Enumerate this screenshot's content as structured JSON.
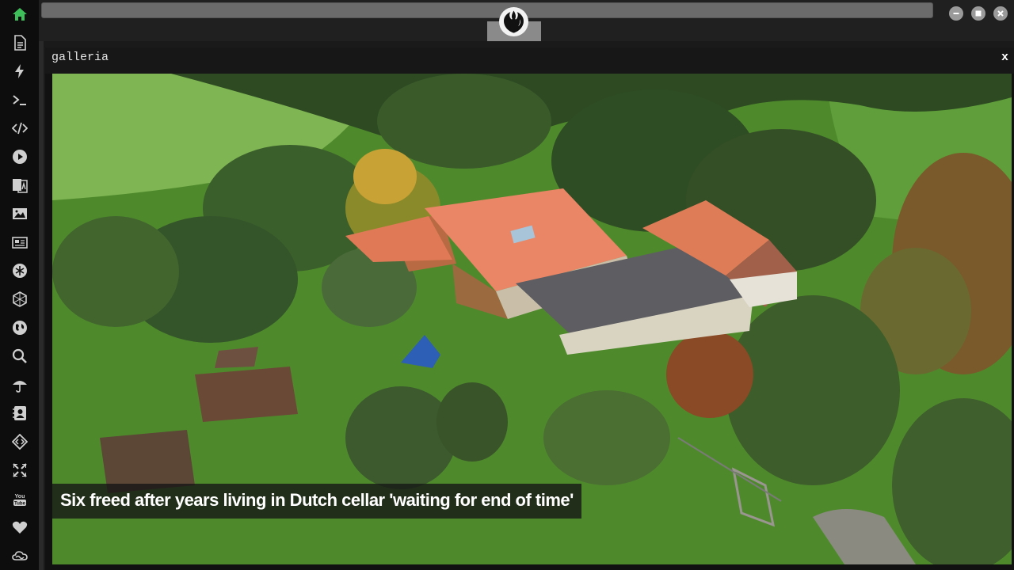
{
  "window": {
    "title": "galleria",
    "close_label": "x"
  },
  "sidebar": {
    "items": [
      {
        "name": "home-icon",
        "active": true
      },
      {
        "name": "document-icon"
      },
      {
        "name": "lightning-icon"
      },
      {
        "name": "terminal-icon"
      },
      {
        "name": "code-icon"
      },
      {
        "name": "play-icon"
      },
      {
        "name": "translate-icon"
      },
      {
        "name": "image-icon"
      },
      {
        "name": "news-icon"
      },
      {
        "name": "snowflake-badge-icon"
      },
      {
        "name": "hexagon-icon"
      },
      {
        "name": "globe-icon"
      },
      {
        "name": "search-icon"
      },
      {
        "name": "umbrella-icon"
      },
      {
        "name": "contact-card-icon"
      },
      {
        "name": "diamond-code-icon"
      },
      {
        "name": "expand-icon"
      },
      {
        "name": "youtube-icon"
      },
      {
        "name": "heart-icon"
      },
      {
        "name": "cloud-icon"
      }
    ]
  },
  "gallery": {
    "caption": "Six freed after years living in Dutch cellar 'waiting for end of time'"
  },
  "colors": {
    "accent": "#3fbf5a",
    "icon": "#cfcfcf",
    "background": "#1a1a1a"
  }
}
